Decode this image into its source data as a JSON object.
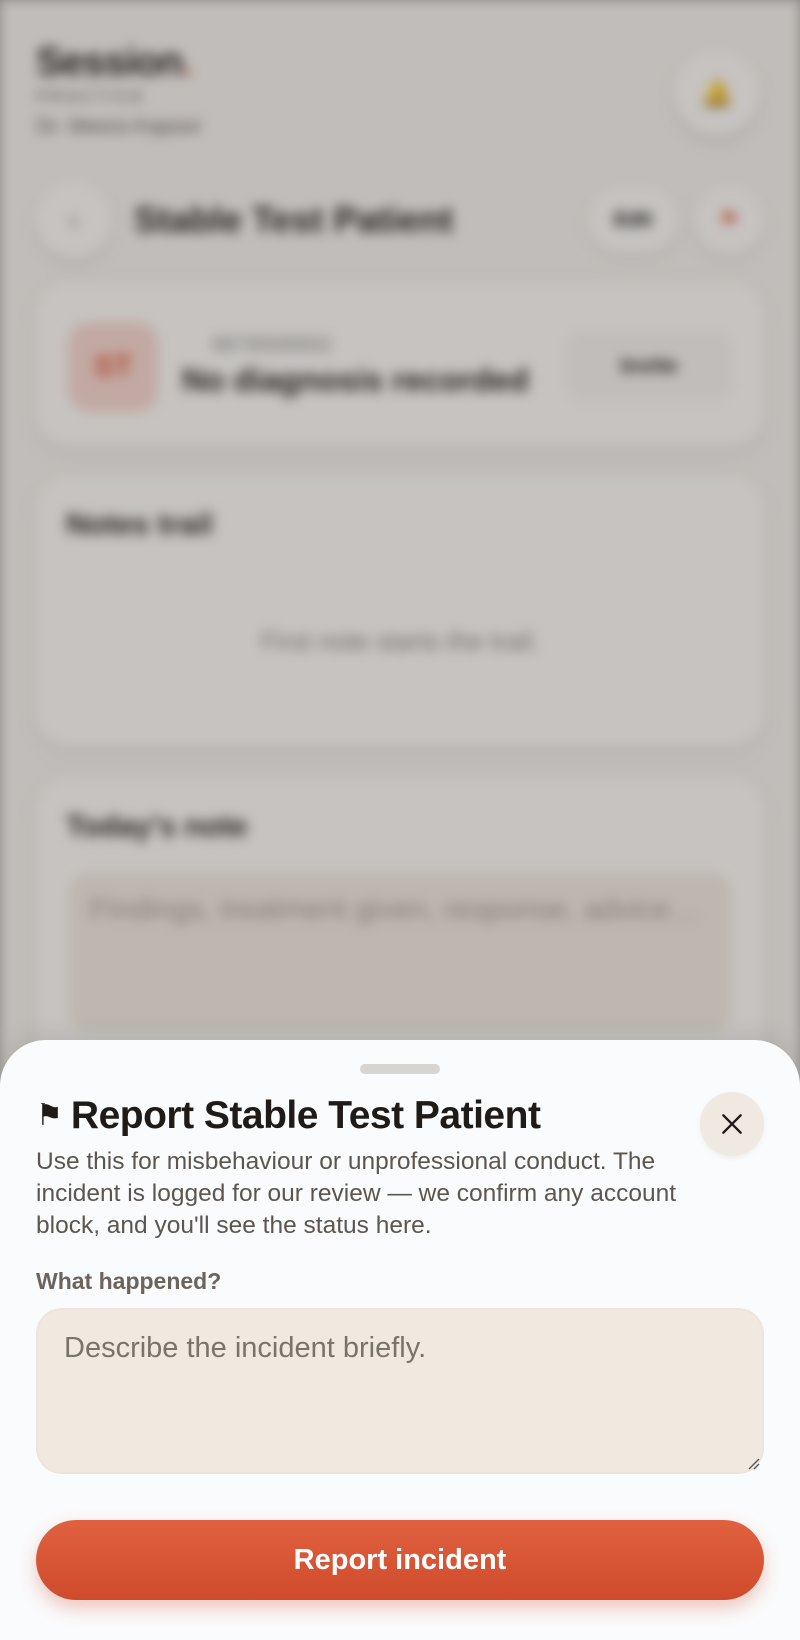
{
  "app": {
    "brand": "Session",
    "brand_dot": ".",
    "brand_sub": "PRACTICE",
    "doctor": "Dr. Meera Kapoor",
    "bell_icon": "bell-icon"
  },
  "patient": {
    "back_label": "‹",
    "name": "Stable Test Patient",
    "edit_label": "Edit",
    "initials": "ST",
    "phone": "9876500002",
    "diagnosis": "No diagnosis recorded",
    "invite_label": "Invite"
  },
  "notes": {
    "heading": "Notes trail",
    "empty_text": "First note starts the trail."
  },
  "today": {
    "heading": "Today's note",
    "placeholder": "Findings, treatment given, response, advice…"
  },
  "sheet": {
    "flag_icon": "⚑",
    "title": "Report Stable Test Patient",
    "description": "Use this for misbehaviour or unprofessional conduct. The incident is logged for our review — we confirm any account block, and you'll see the status here.",
    "field_label": "What happened?",
    "field_placeholder": "Describe the incident briefly.",
    "field_value": "",
    "submit_label": "Report incident"
  },
  "colors": {
    "accent": "#d9512f",
    "sheet_bg": "#fafbfc",
    "input_bg": "#f1e9df"
  }
}
